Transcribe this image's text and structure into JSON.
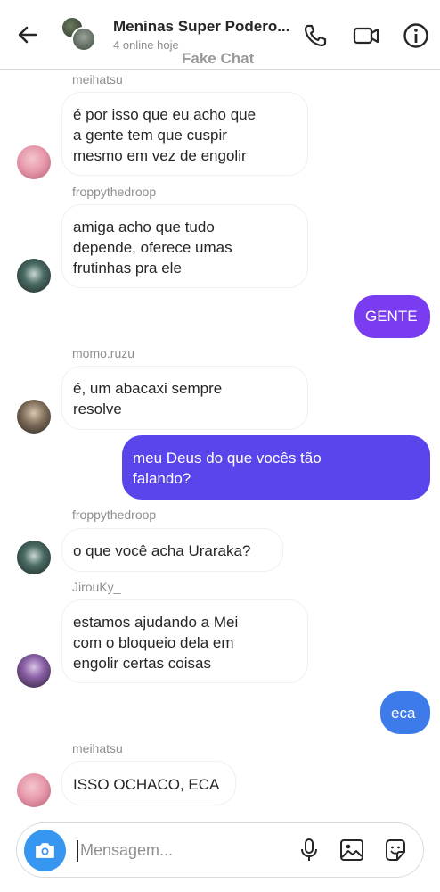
{
  "header": {
    "title": "Meninas Super Podero...",
    "subtitle": "4 online hoje",
    "watermark": "Fake Chat"
  },
  "colors": {
    "accent": "#3797f0",
    "outgoing_gradient_top": "#7a3cf0",
    "outgoing_gradient_mid": "#5a45ec",
    "outgoing_gradient_bottom": "#3d7bea",
    "incoming_border": "#efefef",
    "muted_text": "#8e8e8e"
  },
  "messages": [
    {
      "sender": "meihatsu",
      "text": "é por isso que eu acho que\na gente tem que cuspir\nmesmo em vez de engolir"
    },
    {
      "sender": "froppythedroop",
      "text": "amiga acho que tudo\ndepende, oferece umas\nfrutinhas pra ele"
    },
    {
      "sender": "me",
      "text": "GENTE"
    },
    {
      "sender": "momo.ruzu",
      "text": "é, um abacaxi sempre\nresolve"
    },
    {
      "sender": "me",
      "text": "meu Deus do que vocês tão\nfalando?"
    },
    {
      "sender": "froppythedroop",
      "text": "o que você acha Uraraka?"
    },
    {
      "sender": "JirouKy_",
      "text": "estamos ajudando a Mei\ncom o bloqueio dela em\nengolir certas coisas"
    },
    {
      "sender": "me",
      "text": "eca"
    },
    {
      "sender": "meihatsu",
      "text": "ISSO OCHACO, ECA"
    }
  ],
  "composer": {
    "placeholder": "Mensagem..."
  },
  "icons": {
    "back": "back-arrow-icon",
    "call": "phone-icon",
    "video": "video-camera-icon",
    "info": "info-icon",
    "camera": "camera-icon",
    "mic": "microphone-icon",
    "gallery": "image-icon",
    "sticker": "sticker-icon"
  }
}
